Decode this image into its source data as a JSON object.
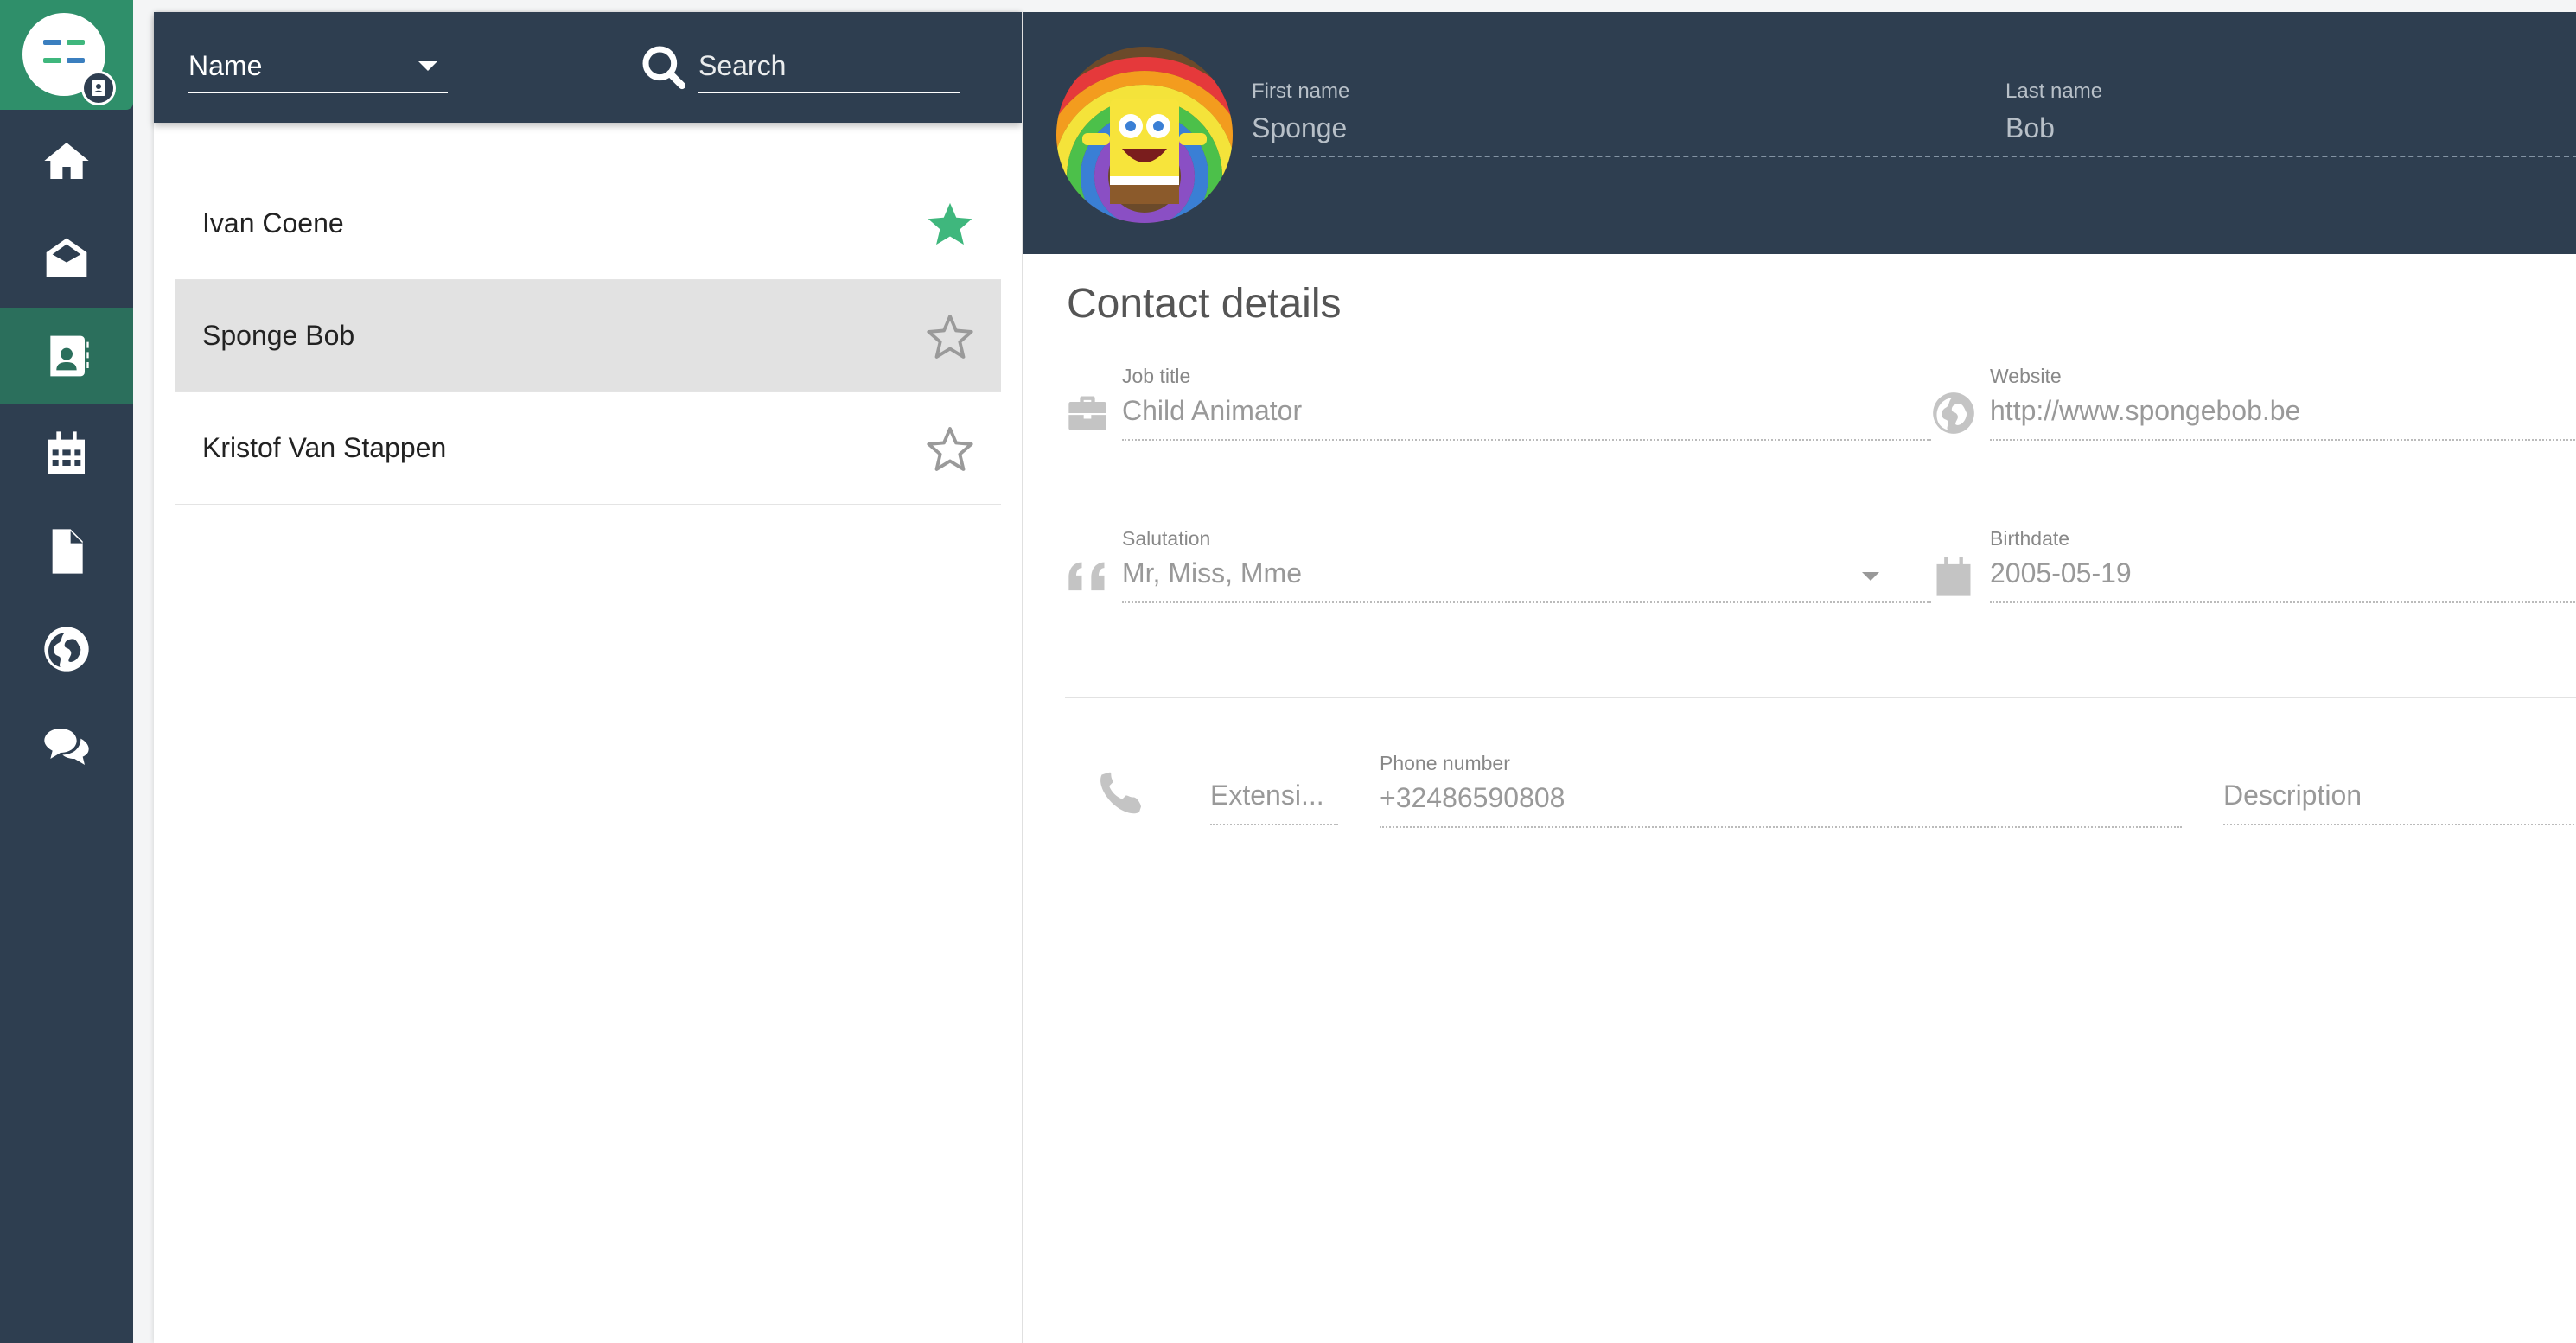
{
  "nav": {
    "items": [
      {
        "name": "home",
        "active": false
      },
      {
        "name": "mail",
        "active": false
      },
      {
        "name": "contacts",
        "active": true
      },
      {
        "name": "calendar",
        "active": false
      },
      {
        "name": "files",
        "active": false
      },
      {
        "name": "web",
        "active": false
      },
      {
        "name": "chat",
        "active": false
      }
    ]
  },
  "list": {
    "sort_label": "Name",
    "search_placeholder": "Search",
    "contacts": [
      {
        "name": "Ivan Coene",
        "starred": true,
        "selected": false
      },
      {
        "name": "Sponge Bob",
        "starred": false,
        "selected": true
      },
      {
        "name": "Kristof Van Stappen",
        "starred": false,
        "selected": false
      }
    ]
  },
  "detail": {
    "first_name_label": "First name",
    "first_name": "Sponge",
    "last_name_label": "Last name",
    "last_name": "Bob",
    "section_title": "Contact details",
    "job_title_label": "Job title",
    "job_title": "Child Animator",
    "website_label": "Website",
    "website": "http://www.spongebob.be",
    "salutation_label": "Salutation",
    "salutation": "Mr, Miss, Mme",
    "birthdate_label": "Birthdate",
    "birthdate": "2005-05-19",
    "phone": {
      "extension_placeholder": "Extensi...",
      "number_label": "Phone number",
      "number": "+32486590808",
      "description_placeholder": "Description"
    }
  },
  "colors": {
    "rail": "#2e3e50",
    "accent": "#2f8f6a",
    "star_active": "#3fb77d",
    "star_inactive": "#9a9a9a"
  }
}
